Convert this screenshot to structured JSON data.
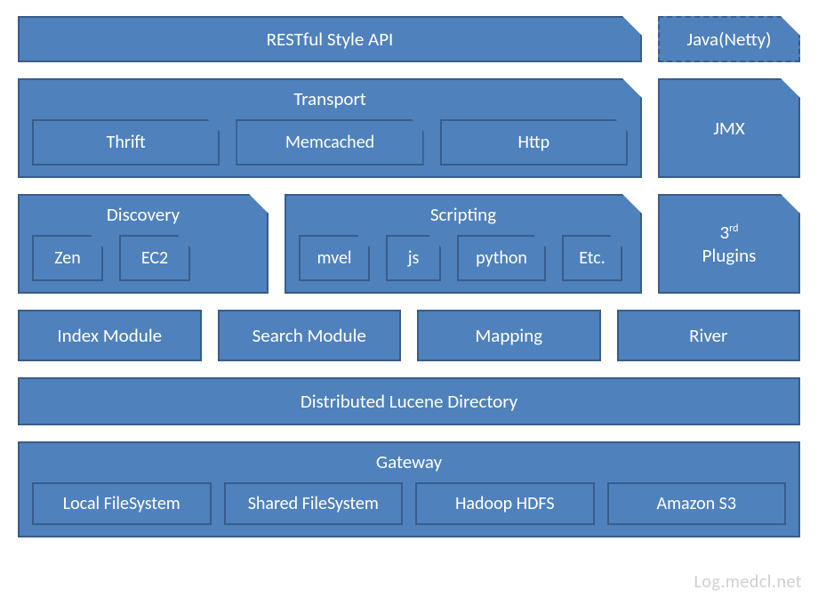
{
  "row1": {
    "api": "RESTful Style API",
    "java": "Java(Netty)"
  },
  "transport": {
    "title": "Transport",
    "items": [
      "Thrift",
      "Memcached",
      "Http"
    ],
    "side": "JMX"
  },
  "discovery": {
    "title": "Discovery",
    "items": [
      "Zen",
      "EC2"
    ]
  },
  "scripting": {
    "title": "Scripting",
    "items": [
      "mvel",
      "js",
      "python",
      "Etc."
    ]
  },
  "plugins": {
    "label": "3",
    "ord": "rd",
    "sub": "Plugins"
  },
  "modules": [
    "Index Module",
    "Search Module",
    "Mapping",
    "River"
  ],
  "distributed": "Distributed Lucene Directory",
  "gateway": {
    "title": "Gateway",
    "items": [
      "Local FileSystem",
      "Shared FileSystem",
      "Hadoop HDFS",
      "Amazon S3"
    ]
  },
  "watermark": "Log.medcl.net"
}
